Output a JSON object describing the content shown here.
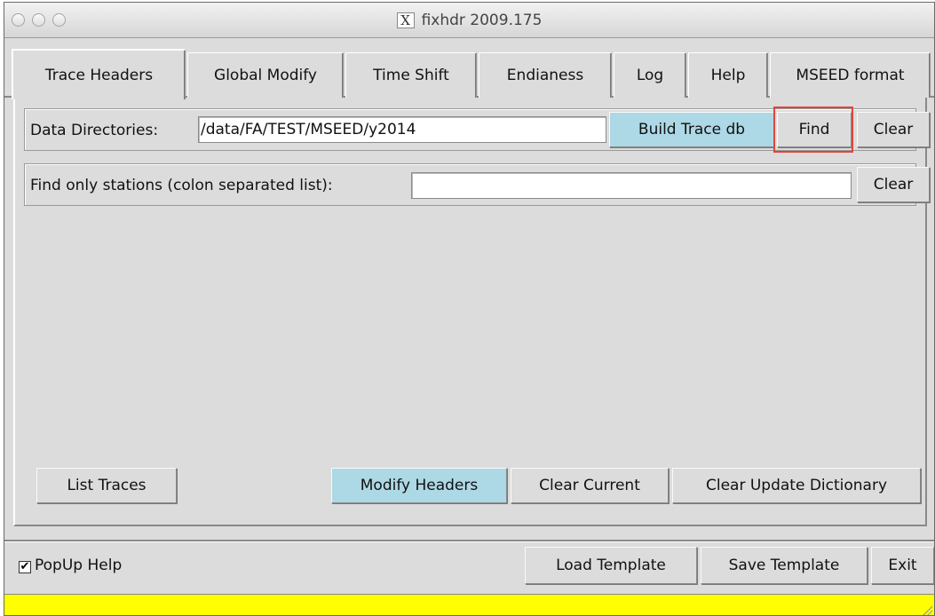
{
  "window": {
    "title": "fixhdr 2009.175",
    "title_icon": "X"
  },
  "tabs": [
    {
      "label": "Trace Headers",
      "active": true
    },
    {
      "label": "Global Modify",
      "active": false
    },
    {
      "label": "Time Shift",
      "active": false
    },
    {
      "label": "Endianess",
      "active": false
    },
    {
      "label": "Log",
      "active": false
    },
    {
      "label": "Help",
      "active": false
    },
    {
      "label": "MSEED format",
      "active": false
    }
  ],
  "data_dirs": {
    "label": "Data Directories:",
    "value": "/data/FA/TEST/MSEED/y2014",
    "build_label": "Build Trace db",
    "find_label": "Find",
    "clear_label": "Clear"
  },
  "stations": {
    "label": "Find only stations (colon separated list):",
    "value": "",
    "clear_label": "Clear"
  },
  "actions": {
    "list_traces": "List Traces",
    "modify_headers": "Modify Headers",
    "clear_current": "Clear Current",
    "clear_update_dictionary": "Clear Update Dictionary"
  },
  "bottom": {
    "popup_help": "PopUp Help",
    "popup_checked": true,
    "check_mark": "✔",
    "load_template": "Load Template",
    "save_template": "Save Template",
    "exit": "Exit"
  },
  "status": {
    "text": ""
  },
  "colors": {
    "accent_button": "#add8e6",
    "status_bar": "#ffff00",
    "highlight": "#e0443a"
  }
}
